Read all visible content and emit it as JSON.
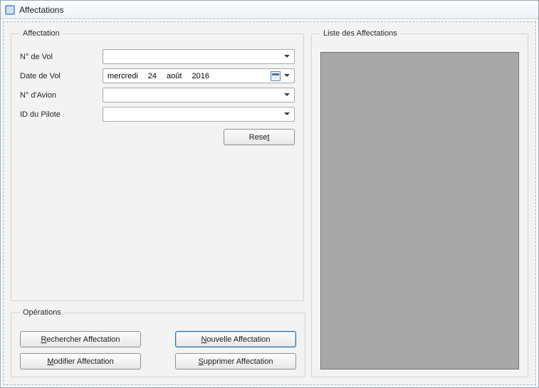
{
  "window": {
    "title": "Affectations"
  },
  "group_affectation": {
    "legend": "Affectation"
  },
  "fields": {
    "vol_label": "N° de Vol",
    "vol_value": "",
    "date_label": "Date de Vol",
    "date_weekday": "mercredi",
    "date_day": "24",
    "date_month": "août",
    "date_year": "2016",
    "avion_label": "N° d'Avion",
    "avion_value": "",
    "pilote_label": "ID du Pilote",
    "pilote_value": ""
  },
  "reset": {
    "pre": "Rese",
    "u": "t"
  },
  "group_operations": {
    "legend": "Opérations"
  },
  "ops": {
    "rechercher": {
      "u": "R",
      "rest": "echercher Affectation"
    },
    "nouvelle": {
      "u": "N",
      "rest": "ouvelle Affectation"
    },
    "modifier": {
      "u": "M",
      "rest": "odifier Affectation"
    },
    "supprimer": {
      "u": "S",
      "rest": "upprimer Affectation"
    }
  },
  "group_list": {
    "legend": "Liste des Affectations"
  }
}
